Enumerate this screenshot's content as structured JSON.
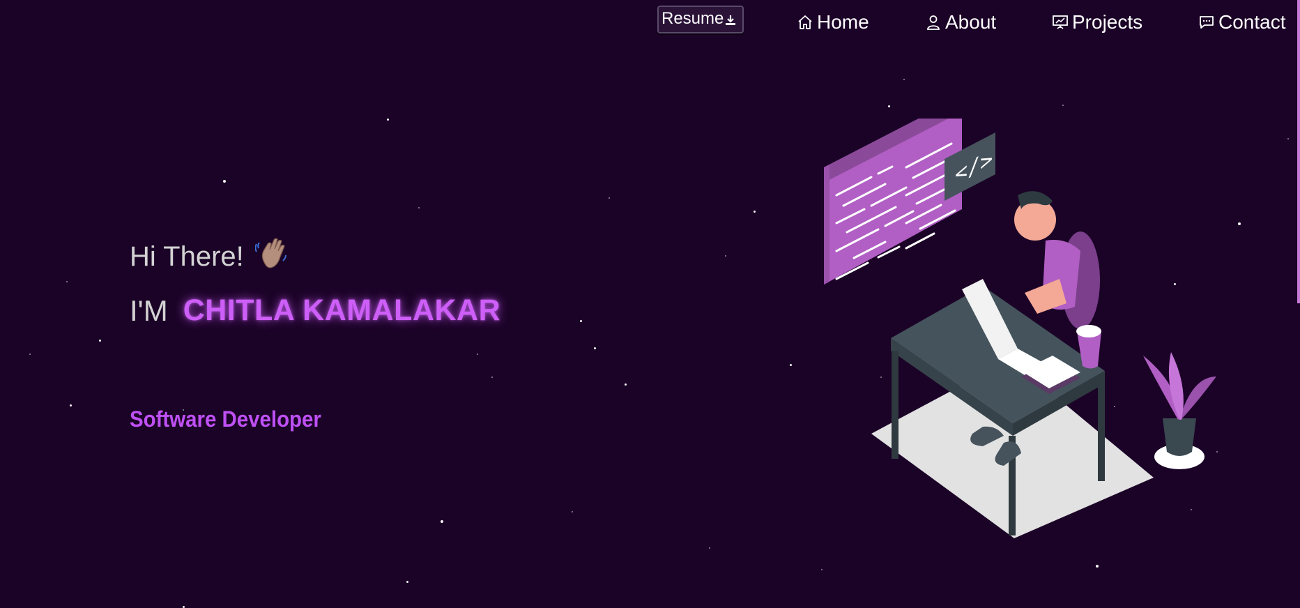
{
  "nav": {
    "resume_label": "Resume",
    "resume_icon": "download-icon",
    "items": [
      {
        "label": "Home",
        "icon": "home-icon"
      },
      {
        "label": "About",
        "icon": "user-icon"
      },
      {
        "label": "Projects",
        "icon": "presentation-chart-icon"
      },
      {
        "label": "Contact",
        "icon": "chat-bubble-icon"
      }
    ]
  },
  "hero": {
    "greeting": "Hi There!",
    "greeting_emoji": "👋🏽",
    "intro_prefix": "I'M",
    "name": "CHITLA KAMALAKAR",
    "role": "Software Developer"
  },
  "colors": {
    "background": "#1b0327",
    "accent": "#cd5ff8",
    "role": "#be50f4",
    "text_muted": "#d3d3d3"
  }
}
